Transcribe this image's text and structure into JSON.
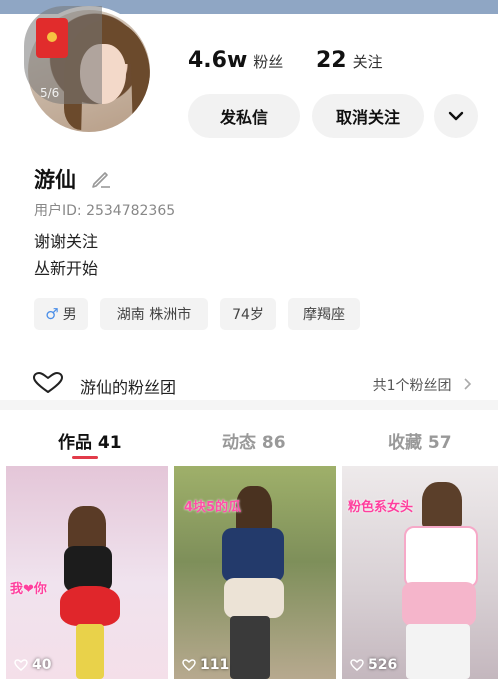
{
  "header": {
    "redpacket_count": "5/6",
    "followers_value": "4.6w",
    "followers_label": "粉丝",
    "following_value": "22",
    "following_label": "关注"
  },
  "actions": {
    "message_label": "发私信",
    "unfollow_label": "取消关注",
    "more_icon": "chevron-down-icon"
  },
  "profile": {
    "name": "游仙",
    "user_id": "用户ID: 2534782365",
    "bio_line1": "谢谢关注",
    "bio_line2": "丛新开始",
    "tags": {
      "gender": "男",
      "location": "湖南 株洲市",
      "age": "74岁",
      "zodiac": "摩羯座"
    }
  },
  "fan_group": {
    "title": "游仙的粉丝团",
    "count_text": "共1个粉丝团"
  },
  "tabs": [
    {
      "label": "作品 41",
      "active": true
    },
    {
      "label": "动态 86",
      "active": false
    },
    {
      "label": "收藏 57",
      "active": false
    }
  ],
  "posts": [
    {
      "likes": "40",
      "overlay": "我❤你"
    },
    {
      "likes": "111",
      "overlay": "4块5的瓜"
    },
    {
      "likes": "526",
      "overlay": "粉色系女头"
    }
  ],
  "colors": {
    "accent_underline": "#e23b4a",
    "male_icon": "#4a8ee8"
  }
}
